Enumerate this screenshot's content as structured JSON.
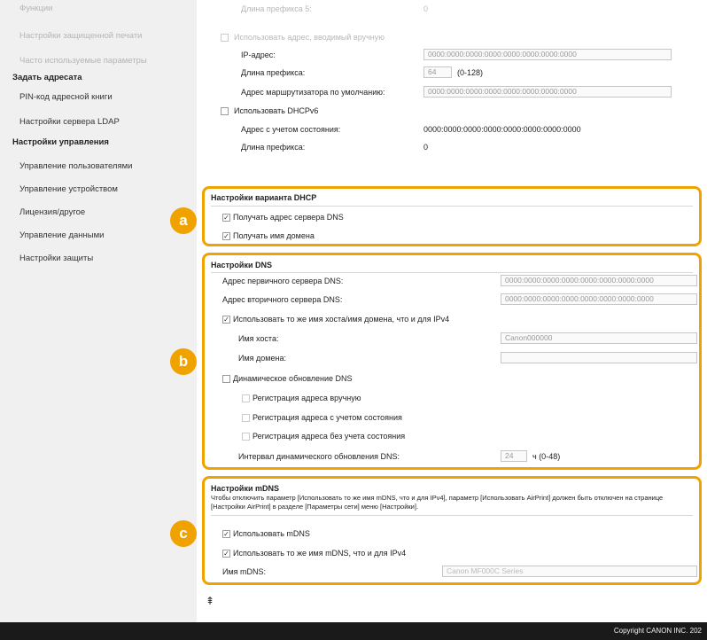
{
  "sidebar": {
    "faded_top": "Функции",
    "items_top": [
      "Настройки защищенной печати",
      "Часто используемые параметры"
    ],
    "group1_head": "Задать адресата",
    "group1_items": [
      "PIN-код адресной книги",
      "Настройки сервера LDAP"
    ],
    "group2_head": "Настройки управления",
    "group2_items": [
      "Управление пользователями",
      "Управление устройством",
      "Лицензия/другое",
      "Управление данными",
      "Настройки защиты"
    ]
  },
  "ipv6": {
    "prefix_len_label": "Длина префикса 5:",
    "prefix_len_value": "0",
    "manual_checkbox_label": "Использовать адрес, вводимый вручную",
    "ip_label": "IP-адрес:",
    "ip_value": "0000:0000:0000:0000:0000:0000:0000:0000",
    "prefix_label": "Длина префикса:",
    "prefix_value": "64",
    "prefix_range": "(0-128)",
    "gateway_label": "Адрес маршрутизатора по умолчанию:",
    "gateway_value": "0000:0000:0000:0000:0000:0000:0000:0000",
    "dhcpv6_label": "Использовать DHCPv6",
    "stateful_label": "Адрес с учетом состояния:",
    "stateful_value": "0000:0000:0000:0000:0000:0000:0000:0000",
    "dhcp_prefix_label": "Длина префикса:",
    "dhcp_prefix_value": "0"
  },
  "dhcp_options": {
    "title": "Настройки варианта DHCP",
    "get_dns_label": "Получать адрес сервера DNS",
    "get_domain_label": "Получать имя домена",
    "get_dns_checked": "✓",
    "get_domain_checked": "✓"
  },
  "dns": {
    "title": "Настройки DNS",
    "primary_label": "Адрес первичного сервера DNS:",
    "primary_value": "0000:0000:0000:0000:0000:0000:0000:0000",
    "secondary_label": "Адрес вторичного сервера DNS:",
    "secondary_value": "0000:0000:0000:0000:0000:0000:0000:0000",
    "same_host_label": "Использовать то же имя хоста/имя домена, что и для IPv4",
    "same_host_checked": "✓",
    "host_label": "Имя хоста:",
    "host_value": "Canon000000",
    "domain_label": "Имя домена:",
    "domain_value": "",
    "dyn_label": "Динамическое обновление DNS",
    "reg_manual_label": "Регистрация адреса вручную",
    "reg_stateful_label": "Регистрация адреса с учетом состояния",
    "reg_stateless_label": "Регистрация адреса без учета состояния",
    "interval_label": "Интервал динамического обновления DNS:",
    "interval_value": "24",
    "interval_unit": "ч (0-48)"
  },
  "mdns": {
    "title": "Настройки mDNS",
    "note": "Чтобы отключить параметр [Использовать то же имя mDNS, что и для IPv4], параметр [Использовать AirPrint] должен быть отключен на странице [Настройки AirPrint] в разделе [Параметры сети] меню [Настройки].",
    "use_label": "Использовать mDNS",
    "use_checked": "✓",
    "same_label": "Использовать то же имя mDNS, что и для IPv4",
    "same_checked": "✓",
    "name_label": "Имя mDNS:",
    "name_value": "Canon MF000C Series"
  },
  "badges": {
    "a": "a",
    "b": "b",
    "c": "c"
  },
  "to_top_icon": "⇞",
  "footer": {
    "copyright": "Copyright CANON INC. 202"
  },
  "colors": {
    "accent": "#f0a300",
    "footer_bg": "#1a1a1a"
  }
}
